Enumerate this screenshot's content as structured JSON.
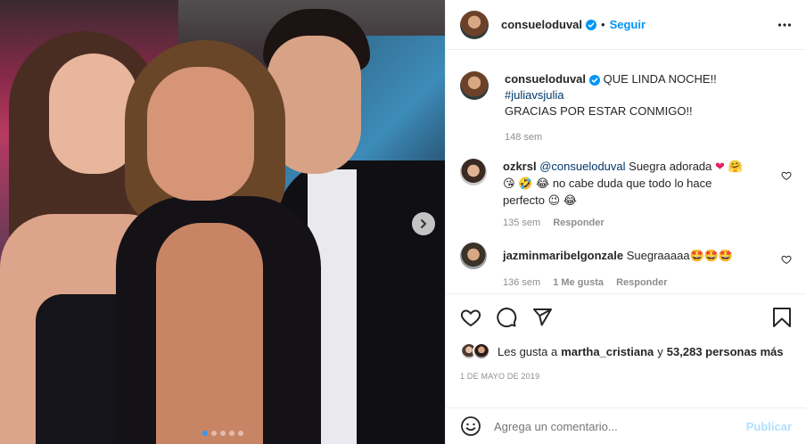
{
  "header": {
    "username": "consueloduval",
    "separator": "•",
    "follow_label": "Seguir"
  },
  "caption": {
    "username": "consueloduval",
    "text": "QUE LINDA NOCHE!!",
    "hashtag": "#juliavsjulia",
    "text2": "GRACIAS POR ESTAR CONMIGO!!",
    "time": "148 sem"
  },
  "comments": [
    {
      "username": "ozkrsl",
      "mention": "@consueloduval",
      "text": "Suegra adorada",
      "line2": "no cabe duda que todo lo hace",
      "line3": "perfecto",
      "time": "135 sem",
      "reply_label": "Responder"
    },
    {
      "username": "jazminmaribelgonzale",
      "text": "Suegraaaaa",
      "time": "136 sem",
      "likes_label": "1 Me gusta",
      "reply_label": "Responder"
    }
  ],
  "likes": {
    "prefix": "Les gusta a",
    "user": "martha_cristiana",
    "conj": "y",
    "others": "53,283 personas más"
  },
  "date": "1 DE MAYO DE 2019",
  "add_comment": {
    "placeholder": "Agrega un comentario...",
    "publish_label": "Publicar"
  },
  "carousel": {
    "total_dots": 5,
    "active_index": 0
  },
  "colors": {
    "accent": "#0095f6",
    "heart": "#ed4956",
    "publish_disabled": "#b2dffc"
  }
}
